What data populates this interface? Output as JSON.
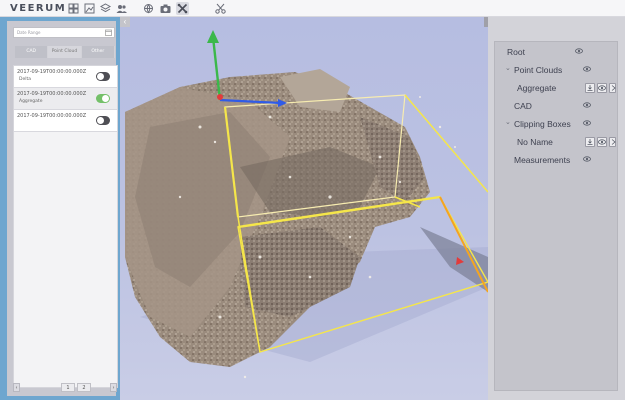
{
  "app": {
    "logo_text": "VEERUM"
  },
  "toolbar": {
    "icons": [
      "grid-icon",
      "image-icon",
      "layers-icon",
      "users-icon",
      "globe-icon",
      "camera-icon",
      "settings-tools-icon",
      "scissors-icon"
    ],
    "active_icon": "settings-tools-icon"
  },
  "left_panel": {
    "search_placeholder": "Date Range",
    "tabs": [
      "CAD",
      "Point Cloud",
      "Other"
    ],
    "active_tab": "Point Cloud",
    "items": [
      {
        "date": "2017-09-19T00:00:00.000Z",
        "sub": "Delta",
        "on": false
      },
      {
        "date": "2017-09-19T00:00:00.000Z",
        "sub": "Aggregate",
        "on": true
      },
      {
        "date": "2017-09-19T00:00:00.000Z",
        "sub": "",
        "on": false
      }
    ],
    "pager": {
      "prev": "‹",
      "pages": [
        "1",
        "2"
      ],
      "next": "›"
    }
  },
  "right_panel": {
    "tree": [
      {
        "label": "Root",
        "level": 0
      },
      {
        "label": "Point Clouds",
        "level": 1,
        "expanded": true
      },
      {
        "label": "Aggregate",
        "level": 2
      },
      {
        "label": "CAD",
        "level": 1
      },
      {
        "label": "Clipping Boxes",
        "level": 1,
        "expanded": true
      },
      {
        "label": "No Name",
        "level": 2
      },
      {
        "label": "Measurements",
        "level": 1
      }
    ]
  },
  "colors": {
    "left_panel_bg": "#6ea6cf",
    "viewport_bg": "#b9bfe1",
    "toggle_on": "#74c069",
    "clip_box": "#f5e64a",
    "axis_x": "#2f5be8",
    "axis_y": "#3bb84a"
  }
}
